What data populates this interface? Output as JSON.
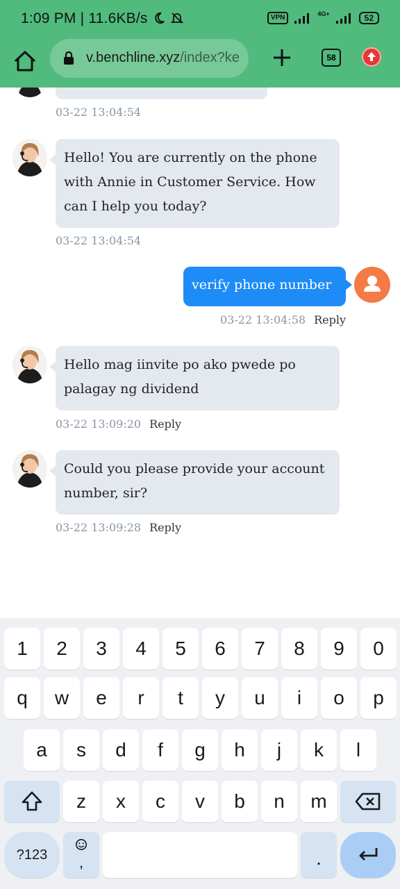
{
  "status_bar": {
    "time": "1:09 PM | 11.6KB/s",
    "vpn": "VPN",
    "network": "4G+",
    "battery": "52"
  },
  "browser": {
    "url_host": "v.benchline.xyz",
    "url_path": "/index?ke",
    "tab_count": "58"
  },
  "chat": {
    "top_timestamp": "03-22 13:04:54",
    "messages": [
      {
        "from": "agent",
        "text_lines": [
          "Hello! You are currently on the phone",
          "with Annie in Customer Service. How",
          "can I help you today?"
        ],
        "time": "03-22 13:04:54",
        "reply": ""
      },
      {
        "from": "user",
        "text_lines": [
          "verify phone number"
        ],
        "time": "03-22 13:04:58",
        "reply": "Reply"
      },
      {
        "from": "agent",
        "text_lines": [
          "Hello mag iinvite po ako pwede po",
          "palagay ng dividend"
        ],
        "time": "03-22 13:09:20",
        "reply": "Reply"
      },
      {
        "from": "agent",
        "text_lines": [
          "Could you please provide your account",
          "number, sir?"
        ],
        "time": "03-22 13:09:28",
        "reply": "Reply"
      }
    ]
  },
  "keyboard": {
    "row_numbers": [
      "1",
      "2",
      "3",
      "4",
      "5",
      "6",
      "7",
      "8",
      "9",
      "0"
    ],
    "row1": [
      "q",
      "w",
      "e",
      "r",
      "t",
      "y",
      "u",
      "i",
      "o",
      "p"
    ],
    "row2": [
      "a",
      "s",
      "d",
      "f",
      "g",
      "h",
      "j",
      "k",
      "l"
    ],
    "row3": [
      "z",
      "x",
      "c",
      "v",
      "b",
      "n",
      "m"
    ],
    "symbols_label": "?123",
    "comma": ",",
    "period": "."
  },
  "colors": {
    "chrome_green": "#50bb7d",
    "user_bubble": "#1e8cf7",
    "agent_bubble": "#e4e9f0",
    "user_avatar": "#f47b45"
  }
}
